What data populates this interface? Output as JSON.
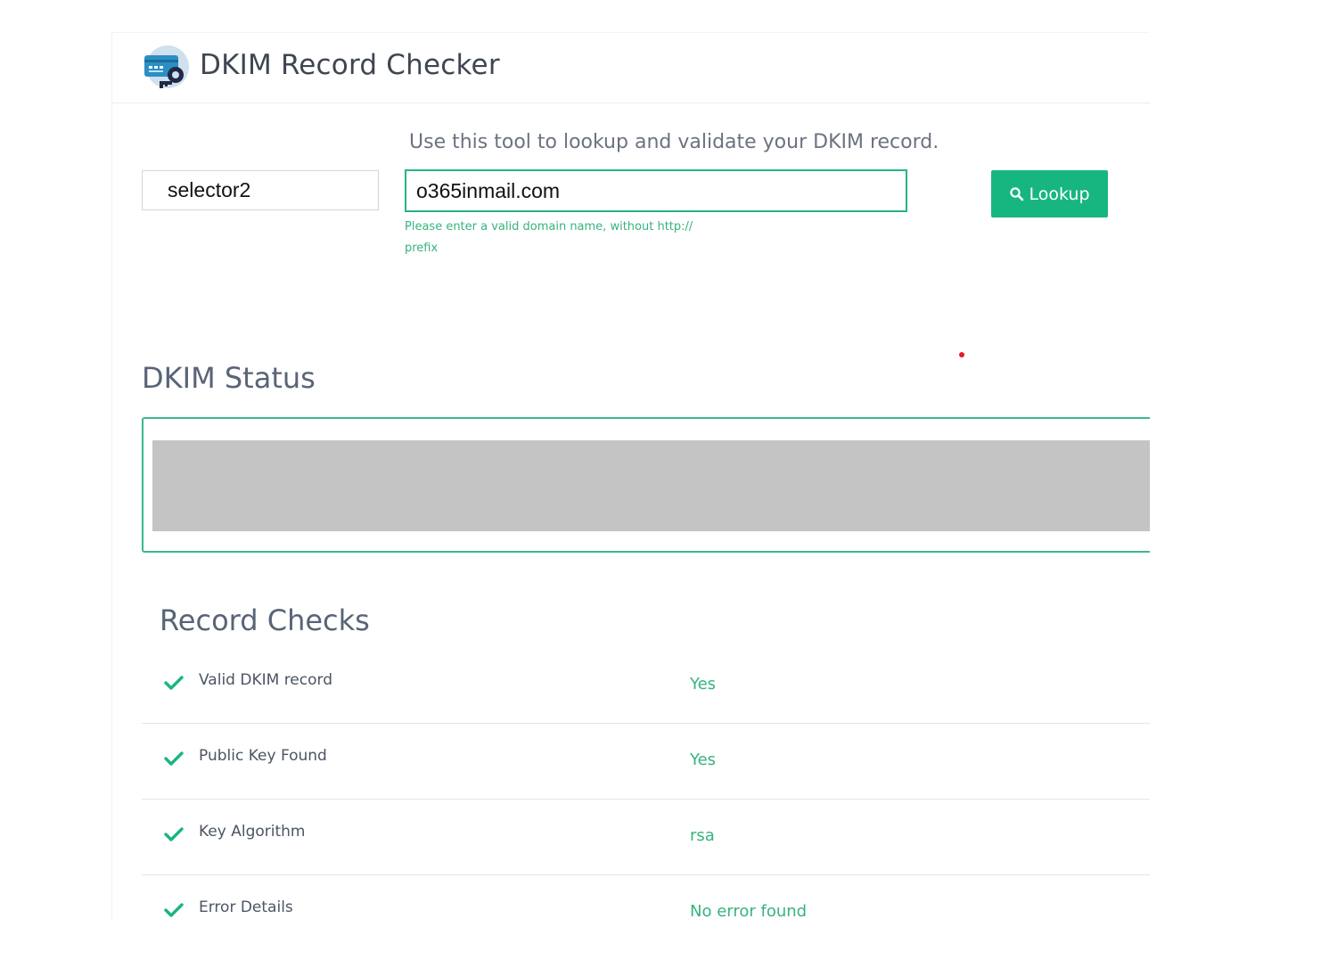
{
  "header": {
    "title": "DKIM Record Checker",
    "icon": "dkim-key-card-icon"
  },
  "form": {
    "description": "Use this tool to lookup and validate your DKIM record.",
    "selector_value": "selector2",
    "domain_value": "o365inmail.com",
    "domain_hint": "Please enter a valid domain name, without http:// prefix",
    "lookup_label": "Lookup",
    "lookup_icon": "search-icon"
  },
  "status": {
    "title": "DKIM Status"
  },
  "record_checks": {
    "title": "Record Checks",
    "items": [
      {
        "label": "Valid DKIM record",
        "value": "Yes",
        "icon": "checkmark-icon"
      },
      {
        "label": "Public Key Found",
        "value": "Yes",
        "icon": "checkmark-icon"
      },
      {
        "label": "Key Algorithm",
        "value": "rsa",
        "icon": "checkmark-icon"
      },
      {
        "label": "Error Details",
        "value": "No error found",
        "icon": "checkmark-icon"
      }
    ]
  },
  "colors": {
    "accent_green": "#17b681",
    "border_green": "#3ab88c",
    "heading_gray": "#596478",
    "redacted_gray": "#c4c4c4"
  }
}
